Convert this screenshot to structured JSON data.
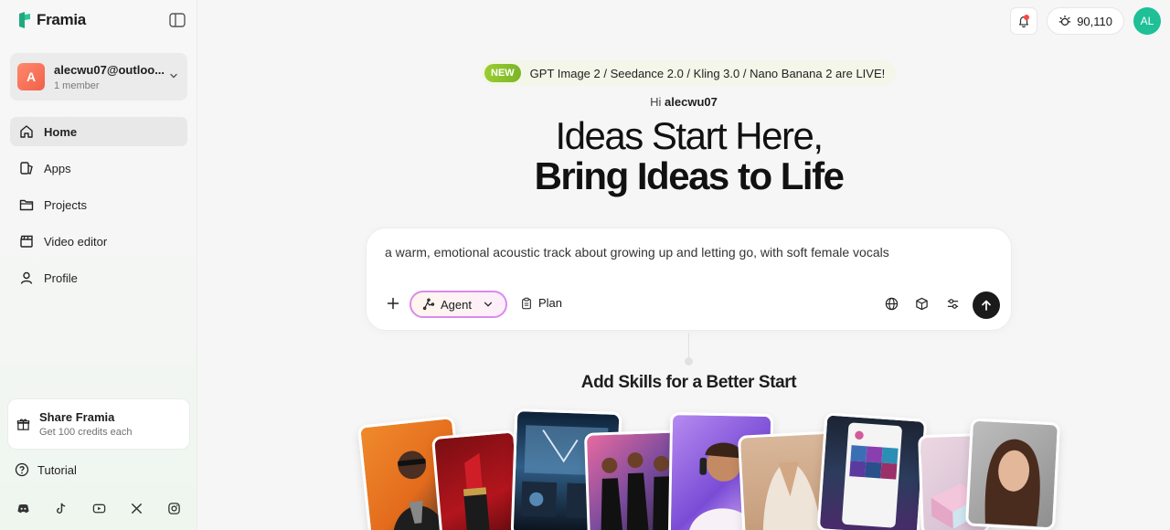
{
  "brand": {
    "name": "Framia"
  },
  "account": {
    "initial": "A",
    "email": "alecwu07@outloo...",
    "members": "1 member"
  },
  "nav": [
    {
      "label": "Home",
      "icon": "home-icon",
      "active": true
    },
    {
      "label": "Apps",
      "icon": "apps-icon"
    },
    {
      "label": "Projects",
      "icon": "folder-icon"
    },
    {
      "label": "Video editor",
      "icon": "clapperboard-icon"
    },
    {
      "label": "Profile",
      "icon": "user-icon"
    }
  ],
  "share": {
    "title": "Share Framia",
    "subtitle": "Get 100 credits each"
  },
  "tutorial": {
    "label": "Tutorial"
  },
  "socials": [
    "discord-icon",
    "tiktok-icon",
    "youtube-icon",
    "x-icon",
    "instagram-icon"
  ],
  "topbar": {
    "credits": "90,110",
    "user_initials": "AL"
  },
  "announcement": {
    "badge": "NEW",
    "text": "GPT Image 2 / Seedance 2.0 / Kling 3.0 / Nano Banana 2 are LIVE!"
  },
  "greeting": {
    "prefix": "Hi",
    "name": "alecwu07"
  },
  "headline": {
    "line1": "Ideas Start Here,",
    "line2": "Bring Ideas to Life"
  },
  "prompt": {
    "text": "a warm, emotional acoustic track about growing up and letting go, with soft female vocals",
    "mode_label": "Agent",
    "plan_label": "Plan"
  },
  "skills": {
    "title": "Add Skills for a Better Start"
  },
  "colors": {
    "accent_green": "#1fbf97",
    "new_badge": "#8cc63f",
    "agent_border": "#d88bf0"
  }
}
